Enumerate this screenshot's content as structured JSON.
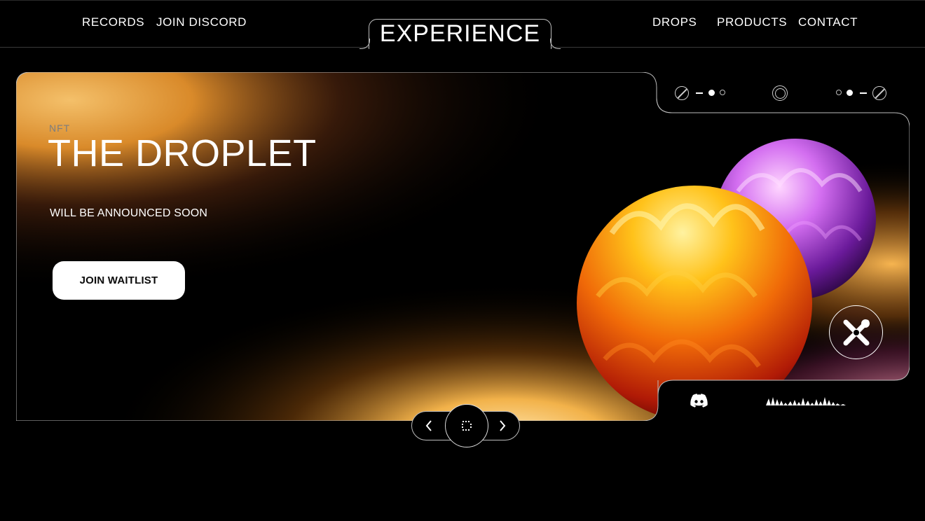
{
  "nav": {
    "left": [
      {
        "label": "RECORDS"
      },
      {
        "label": "JOIN DISCORD"
      }
    ],
    "brand": "EXPERIENCE",
    "right": [
      {
        "label": "DROPS"
      },
      {
        "label": "PRODUCTS"
      },
      {
        "label": "CONTACT"
      }
    ]
  },
  "hero": {
    "label": "NFT",
    "title": "THE DROPLET",
    "subtitle": "WILL BE ANNOUNCED SOON",
    "cta_label": "JOIN WAITLIST"
  },
  "colors": {
    "background": "#000000",
    "accent_gold": "#f3a63a",
    "accent_orange": "#f26a10",
    "accent_purple": "#b44be0",
    "text": "#ffffff"
  },
  "icons": {
    "tab_controls": [
      "slash-circle-icon",
      "dash-icon",
      "dot-filled-icon",
      "dot-outline-icon",
      "ring-icon",
      "dot-outline-icon",
      "dot-filled-icon",
      "dash-icon",
      "slash-circle-icon"
    ],
    "badge": "x-logo-icon",
    "social": "discord-icon",
    "audio": "waveform-icon",
    "pager": [
      "chevron-left-icon",
      "square-dotted-icon",
      "chevron-right-icon"
    ]
  }
}
